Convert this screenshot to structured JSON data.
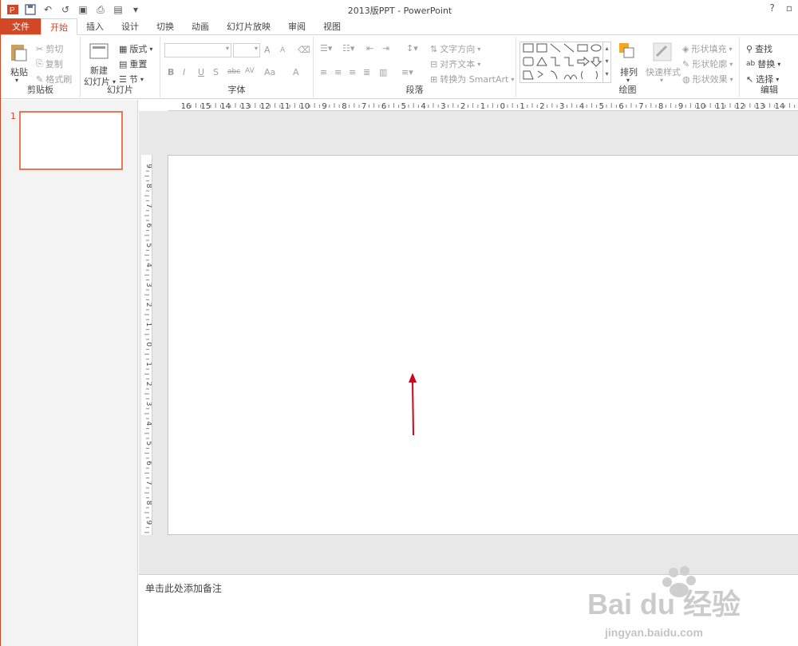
{
  "app": {
    "title": "2013版PPT - PowerPoint"
  },
  "window_controls": {
    "help": "?",
    "restore": "▫"
  },
  "tabs": [
    "文件",
    "开始",
    "插入",
    "设计",
    "切换",
    "动画",
    "幻灯片放映",
    "审阅",
    "视图"
  ],
  "groups": {
    "clipboard": {
      "label": "剪贴板",
      "paste": "粘贴",
      "cut": "剪切",
      "copy": "复制",
      "format_painter": "格式刷"
    },
    "slides": {
      "label": "幻灯片",
      "new_slide_1": "新建",
      "new_slide_2": "幻灯片",
      "layout": "版式",
      "reset": "重置",
      "section": "节"
    },
    "font": {
      "label": "字体",
      "buttons": [
        "B",
        "I",
        "U",
        "S",
        "abc",
        "AV",
        "Aa",
        "A"
      ],
      "grow": "A",
      "shrink": "A"
    },
    "paragraph": {
      "label": "段落",
      "text_direction": "文字方向",
      "align_text": "对齐文本",
      "smartart": "转换为 SmartArt"
    },
    "drawing": {
      "label": "绘图",
      "arrange": "排列",
      "quick_styles": "快速样式",
      "shape_fill": "形状填充",
      "shape_outline": "形状轮廓",
      "shape_effects": "形状效果"
    },
    "editing": {
      "label": "编辑",
      "find": "查找",
      "replace": "替换",
      "select": "选择"
    }
  },
  "ruler_h": [
    "16",
    "15",
    "14",
    "13",
    "12",
    "11",
    "10",
    "9",
    "8",
    "7",
    "6",
    "5",
    "4",
    "3",
    "2",
    "1",
    "0",
    "1",
    "2",
    "3",
    "4",
    "5",
    "6",
    "7",
    "8",
    "9",
    "10",
    "11",
    "12",
    "13",
    "14"
  ],
  "ruler_v": [
    "9",
    "8",
    "7",
    "6",
    "5",
    "4",
    "3",
    "2",
    "1",
    "0",
    "1",
    "2",
    "3",
    "4",
    "5",
    "6",
    "7",
    "8",
    "9"
  ],
  "thumbnail": {
    "number": "1"
  },
  "notes": {
    "placeholder": "单击此处添加备注"
  },
  "colors": {
    "accent": "#d24726",
    "arrow": "#d0021b"
  },
  "watermark": {
    "brand": "Bai du 经验",
    "url": "jingyan.baidu.com"
  }
}
